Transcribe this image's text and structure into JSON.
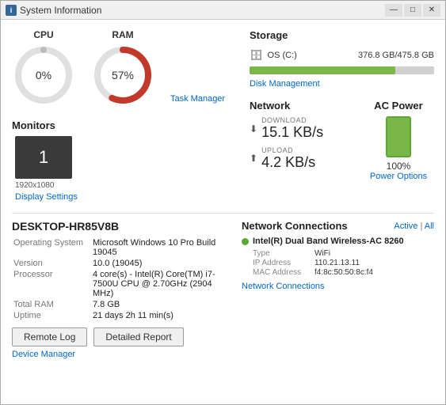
{
  "window": {
    "title": "System Information",
    "icon": "i"
  },
  "titlebar": {
    "minimize": "—",
    "maximize": "□",
    "close": "✕"
  },
  "cpu": {
    "label": "CPU",
    "value": "0%",
    "percent": 0
  },
  "ram": {
    "label": "RAM",
    "value": "57%",
    "percent": 57
  },
  "task_manager_link": "Task Manager",
  "monitors": {
    "title": "Monitors",
    "count": "1",
    "resolution": "1920x1080",
    "link": "Display Settings"
  },
  "storage": {
    "title": "Storage",
    "drive_label": "OS (C:)",
    "drive_used": "376.8 GB",
    "drive_total": "475.8 GB",
    "fill_percent": 79,
    "link": "Disk Management"
  },
  "network": {
    "title": "Network",
    "download_label": "DOWNLOAD",
    "download_value": "15.1 KB/s",
    "upload_label": "UPLOAD",
    "upload_value": "4.2 KB/s"
  },
  "ac_power": {
    "title": "AC Power",
    "percent": "100%",
    "fill_percent": 100,
    "link": "Power Options"
  },
  "system_info": {
    "title": "DESKTOP-HR85V8B",
    "rows": [
      {
        "key": "Operating System",
        "value": "Microsoft Windows 10 Pro Build 19045"
      },
      {
        "key": "Version",
        "value": "10.0 (19045)"
      },
      {
        "key": "Processor",
        "value": "4 core(s) - Intel(R) Core(TM) i7-7500U CPU @ 2.70GHz (2904 MHz)"
      },
      {
        "key": "Total RAM",
        "value": "7.8 GB"
      },
      {
        "key": "Uptime",
        "value": "21 days 2h 11 min(s)"
      }
    ]
  },
  "network_connections": {
    "title": "Network Connections",
    "active_link": "Active",
    "all_link": "All",
    "connection": {
      "name": "Intel(R) Dual Band Wireless-AC 8260",
      "type": "WiFi",
      "ip": "110.21.13.11",
      "mac": "f4:8c:50:50:8c:f4"
    },
    "link": "Network Connections"
  },
  "buttons": {
    "remote_log": "Remote Log",
    "detailed_report": "Detailed Report"
  },
  "device_manager_link": "Device Manager"
}
